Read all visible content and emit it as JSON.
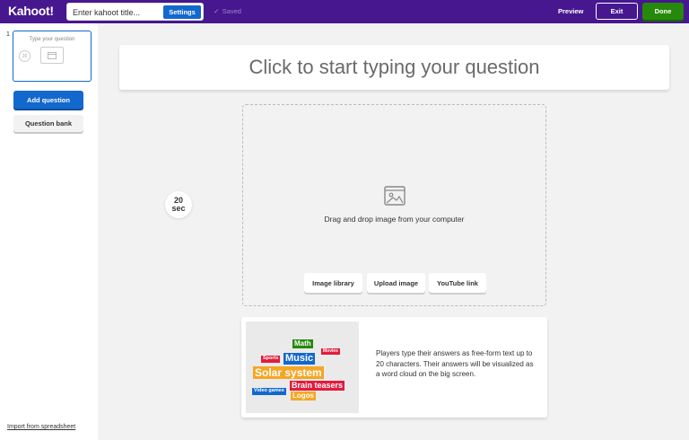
{
  "app": {
    "logo": "Kahoot!"
  },
  "header": {
    "title_placeholder": "Enter kahoot title...",
    "settings_label": "Settings",
    "saved_label": "Saved",
    "preview_label": "Preview",
    "exit_label": "Exit",
    "done_label": "Done"
  },
  "sidebar": {
    "slides": [
      {
        "number": "1",
        "title": "Type your question",
        "circle_text": "20"
      }
    ],
    "add_question_label": "Add question",
    "question_bank_label": "Question bank",
    "import_link": "Import from spreadsheet"
  },
  "editor": {
    "question_placeholder": "Click to start typing your question",
    "timer_value": "20",
    "timer_unit": "sec",
    "drop_text": "Drag and drop image from your computer",
    "image_library_label": "Image library",
    "upload_image_label": "Upload image",
    "youtube_link_label": "YouTube link"
  },
  "info": {
    "text": "Players type their answers as free-form text up to 20 characters. Their answers will be visualized as a word cloud on the big screen.",
    "cloud_words": [
      "Math",
      "Movies",
      "Sports",
      "Music",
      "Solar system",
      "Brain teasers",
      "Video games",
      "Logos"
    ]
  },
  "colors": {
    "topbar": "#46178f",
    "primary_blue": "#1368ce",
    "done_green": "#26890c"
  }
}
